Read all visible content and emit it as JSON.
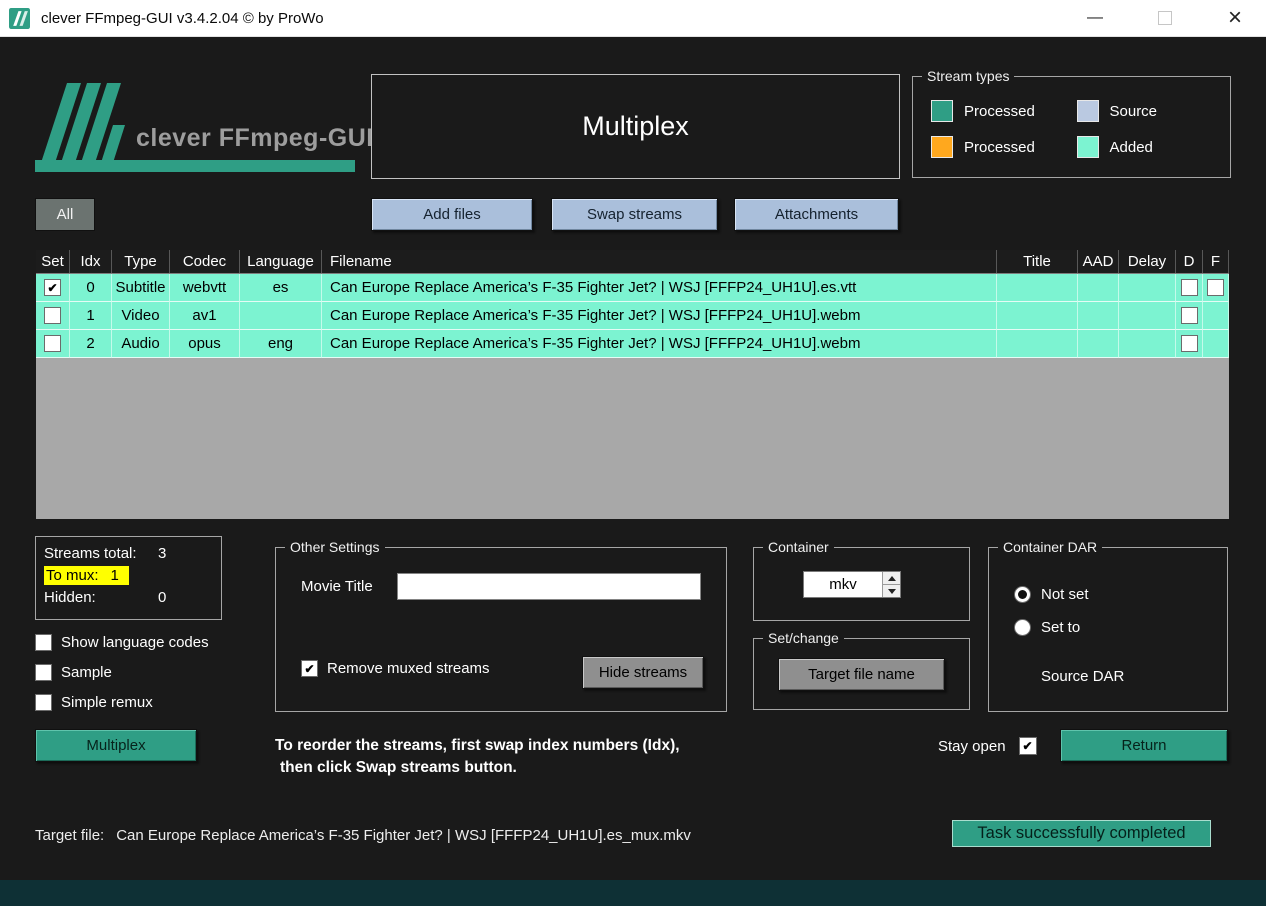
{
  "colors": {
    "accent_teal": "#2f9e85",
    "row_added": "#7cf3d1",
    "highlight_yellow": "#ffff00"
  },
  "titlebar": {
    "title": "clever FFmpeg-GUI v3.4.2.04  © by ProWo",
    "minimize_glyph": "—",
    "close_glyph": "×"
  },
  "header": {
    "logo_text": "clever FFmpeg-GUI",
    "panel_title": "Multiplex",
    "stream_types": {
      "legend": "Stream types",
      "items": [
        {
          "label": "Processed",
          "color": "#2f9e85"
        },
        {
          "label": "Source",
          "color": "#bac9e1"
        },
        {
          "label": "Processed",
          "color": "#ffa81e"
        },
        {
          "label": "Added",
          "color": "#7cf3d1"
        }
      ]
    }
  },
  "toolbar": {
    "all": "All",
    "add_files": "Add files",
    "swap_streams": "Swap streams",
    "attachments": "Attachments"
  },
  "table": {
    "headers": {
      "set": "Set",
      "idx": "Idx",
      "type": "Type",
      "codec": "Codec",
      "language": "Language",
      "filename": "Filename",
      "title": "Title",
      "aad": "AAD",
      "delay": "Delay",
      "d": "D",
      "f": "F"
    },
    "rows": [
      {
        "set": true,
        "idx": "0",
        "type": "Subtitle",
        "codec": "webvtt",
        "language": "es",
        "filename": "Can Europe Replace America’s F-35 Fighter Jet? | WSJ [FFFP24_UH1U].es.vtt",
        "title": "",
        "aad": "",
        "delay": "",
        "d": false,
        "f": false
      },
      {
        "set": false,
        "idx": "1",
        "type": "Video",
        "codec": "av1",
        "language": "",
        "filename": "Can Europe Replace America’s F-35 Fighter Jet? | WSJ [FFFP24_UH1U].webm",
        "title": "",
        "aad": "",
        "delay": "",
        "d": false
      },
      {
        "set": false,
        "idx": "2",
        "type": "Audio",
        "codec": "opus",
        "language": "eng",
        "filename": "Can Europe Replace America’s F-35 Fighter Jet? | WSJ [FFFP24_UH1U].webm",
        "title": "",
        "aad": "",
        "delay": "",
        "d": false
      }
    ]
  },
  "stats": {
    "streams_total_label": "Streams total:",
    "streams_total_value": "3",
    "to_mux_label": "To mux:",
    "to_mux_value": "1",
    "hidden_label": "Hidden:",
    "hidden_value": "0"
  },
  "options": {
    "show_language_codes_label": "Show language codes",
    "show_language_codes_checked": false,
    "sample_label": "Sample",
    "sample_checked": false,
    "simple_remux_label": "Simple remux",
    "simple_remux_checked": false
  },
  "other_settings": {
    "legend": "Other Settings",
    "movie_title_label": "Movie Title",
    "movie_title_value": "",
    "remove_muxed_label": "Remove muxed streams",
    "remove_muxed_checked": true,
    "hide_streams": "Hide streams"
  },
  "container": {
    "legend": "Container",
    "value": "mkv"
  },
  "set_change": {
    "legend": "Set/change",
    "target_file_name": "Target file name"
  },
  "container_dar": {
    "legend": "Container DAR",
    "not_set_label": "Not set",
    "not_set_selected": true,
    "set_to_label": "Set to",
    "set_to_selected": false,
    "source_dar_label": "Source DAR"
  },
  "actions": {
    "multiplex": "Multiplex",
    "return": "Return"
  },
  "note": {
    "line1": "To reorder the streams, first swap index numbers (Idx),",
    "line2": "then click Swap streams button."
  },
  "stay_open": {
    "label": "Stay open",
    "checked": true
  },
  "target_file": {
    "label": "Target file:",
    "value": "Can Europe Replace America’s F-35 Fighter Jet? | WSJ [FFFP24_UH1U].es_mux.mkv"
  },
  "status": {
    "message": "Task successfully completed"
  }
}
